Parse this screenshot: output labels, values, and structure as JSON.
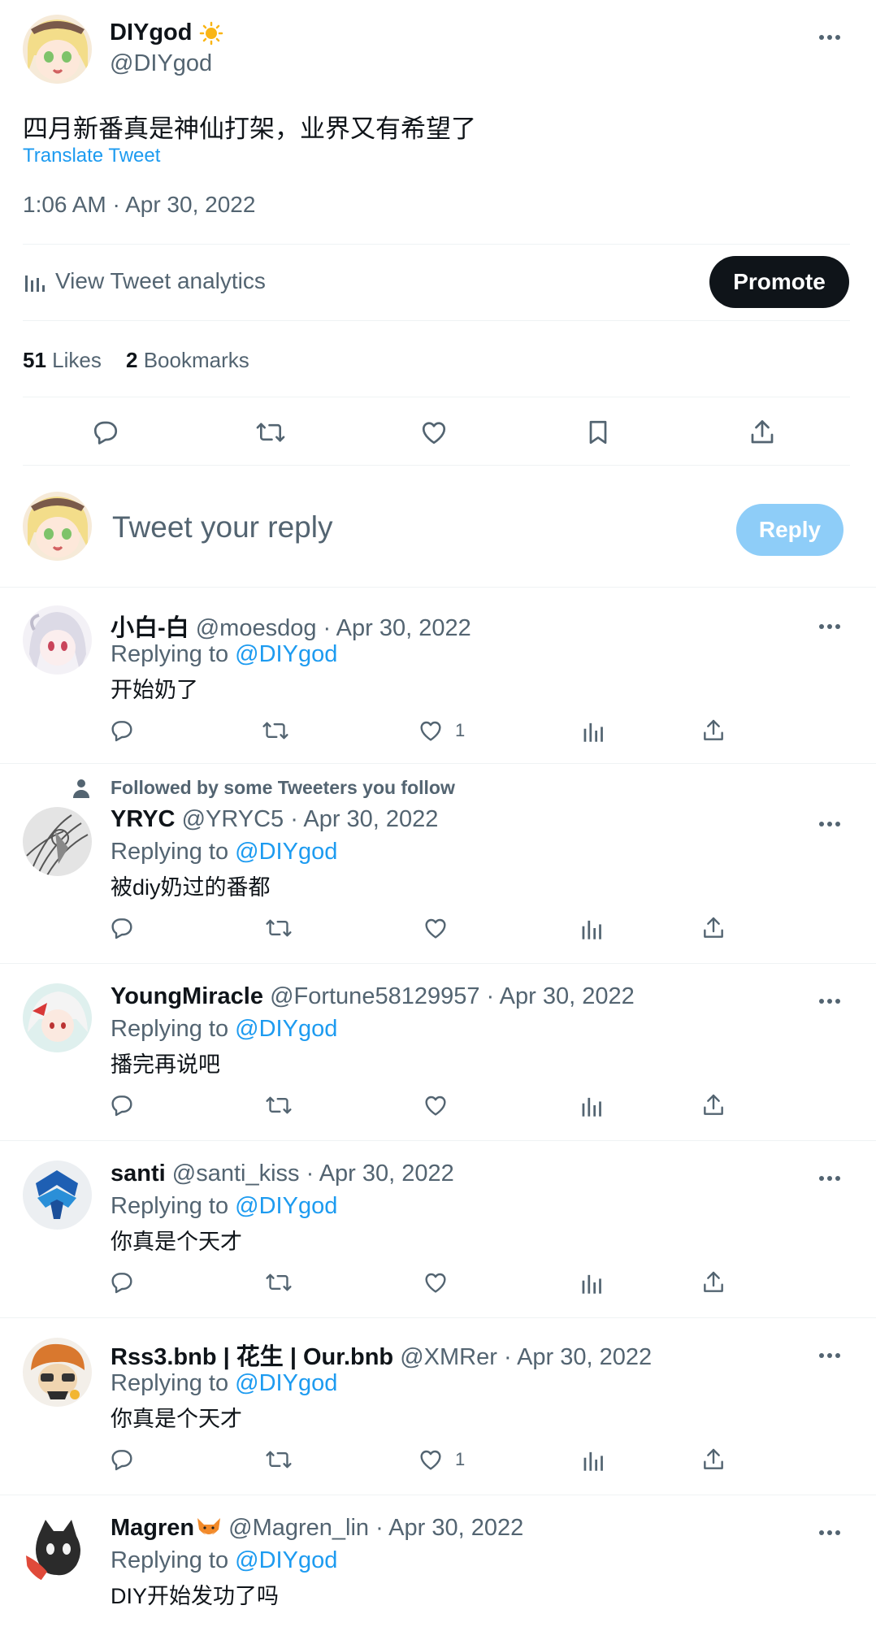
{
  "main": {
    "display_name": "DIYgod",
    "handle": "@DIYgod",
    "text": "四月新番真是神仙打架，业界又有希望了",
    "translate": "Translate Tweet",
    "timestamp": "1:06 AM · Apr 30, 2022",
    "analytics_label": "View Tweet analytics",
    "promote_label": "Promote",
    "likes_count": "51",
    "likes_label": "Likes",
    "bookmarks_count": "2",
    "bookmarks_label": "Bookmarks"
  },
  "composer": {
    "placeholder": "Tweet your reply",
    "reply_label": "Reply"
  },
  "replies": [
    {
      "name": "小白-白",
      "handle": "@moesdog",
      "date": "· Apr 30, 2022",
      "replying_prefix": "Replying to",
      "replying_to": "@DIYgod",
      "text": "开始奶了",
      "like_count": "1"
    },
    {
      "social_context": "Followed by some Tweeters you follow",
      "name": "YRYC",
      "handle": "@YRYC5",
      "date": "· Apr 30, 2022",
      "replying_prefix": "Replying to",
      "replying_to": "@DIYgod",
      "text": "被diy奶过的番都",
      "like_count": ""
    },
    {
      "name": "YoungMiracle",
      "handle": "@Fortune58129957",
      "date": "· Apr 30, 2022",
      "replying_prefix": "Replying to",
      "replying_to": "@DIYgod",
      "text": "播完再说吧",
      "like_count": ""
    },
    {
      "name": "santi",
      "handle": "@santi_kiss",
      "date": "· Apr 30, 2022",
      "replying_prefix": "Replying to",
      "replying_to": "@DIYgod",
      "text": "你真是个天才",
      "like_count": ""
    },
    {
      "name": "Rss3.bnb | 花生 | Our.bnb",
      "handle": "@XMRer",
      "date": "· Apr 30, 2022",
      "replying_prefix": "Replying to",
      "replying_to": "@DIYgod",
      "text": "你真是个天才",
      "like_count": "1"
    },
    {
      "name": "Magren",
      "handle": "@Magren_lin",
      "date": "· Apr 30, 2022",
      "replying_prefix": "Replying to",
      "replying_to": "@DIYgod",
      "text": "DIY开始发功了吗",
      "like_count": ""
    }
  ],
  "colors": {
    "accent": "#1d9bf0",
    "text": "#0f1419",
    "muted": "#536471",
    "border": "#eff3f4",
    "reply_disabled": "#8ecdf8"
  },
  "icons": [
    "sun-emoji",
    "more-icon",
    "analytics-icon",
    "reply-icon",
    "retweet-icon",
    "like-icon",
    "bookmark-icon",
    "share-icon",
    "views-icon",
    "person-icon",
    "fox-emoji"
  ]
}
